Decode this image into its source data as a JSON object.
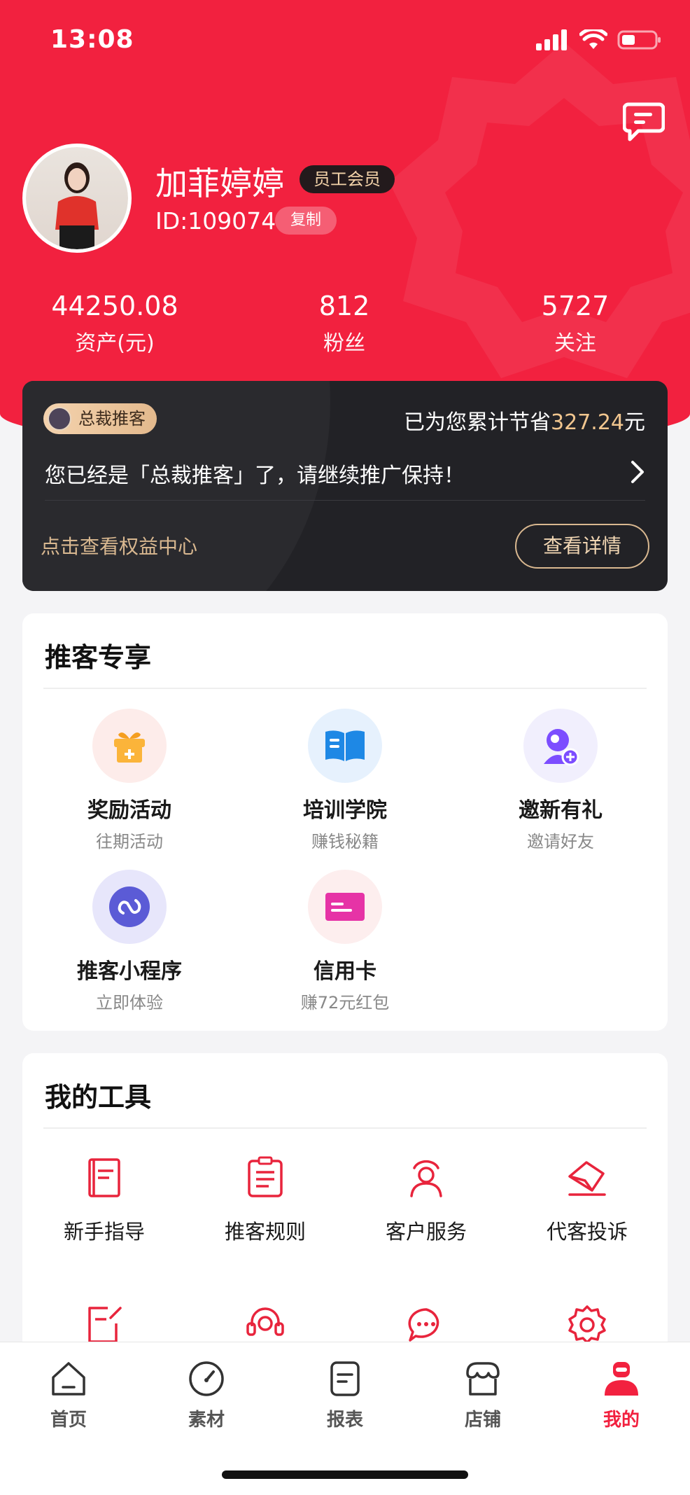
{
  "status_bar": {
    "time": "13:08"
  },
  "profile": {
    "name": "加菲婷婷",
    "member_badge": "员工会员",
    "id_text": "ID:109074",
    "copy_label": "复制"
  },
  "stats": [
    {
      "value": "44250.08",
      "label": "资产(元)"
    },
    {
      "value": "812",
      "label": "粉丝"
    },
    {
      "value": "5727",
      "label": "关注"
    }
  ],
  "vip": {
    "tag": "总裁推客",
    "save_prefix": "已为您累计节省",
    "save_amount": "327.24",
    "save_unit": "元",
    "description": "您已经是「总裁推客」了，请继续推广保持！",
    "center_link": "点击查看权益中心",
    "detail_button": "查看详情"
  },
  "exclusive": {
    "title": "推客专享",
    "items": [
      {
        "title": "奖励活动",
        "subtitle": "往期活动",
        "icon": "gift-icon"
      },
      {
        "title": "培训学院",
        "subtitle": "赚钱秘籍",
        "icon": "book-icon"
      },
      {
        "title": "邀新有礼",
        "subtitle": "邀请好友",
        "icon": "invite-user-icon"
      },
      {
        "title": "推客小程序",
        "subtitle": "立即体验",
        "icon": "mini-program-icon"
      },
      {
        "title": "信用卡",
        "subtitle": "赚72元红包",
        "icon": "credit-card-icon"
      }
    ]
  },
  "tools": {
    "title": "我的工具",
    "items": [
      {
        "label": "新手指导",
        "icon": "guide-book-icon"
      },
      {
        "label": "推客规则",
        "icon": "rules-document-icon"
      },
      {
        "label": "客户服务",
        "icon": "customer-service-icon"
      },
      {
        "label": "代客投诉",
        "icon": "complaint-envelope-icon"
      }
    ],
    "partial_row_icons": [
      "edit-document-icon",
      "headset-icon",
      "chat-bubble-icon",
      "settings-gear-icon"
    ]
  },
  "tabbar": [
    {
      "label": "首页",
      "icon": "home-icon"
    },
    {
      "label": "素材",
      "icon": "compass-icon"
    },
    {
      "label": "报表",
      "icon": "report-icon"
    },
    {
      "label": "店铺",
      "icon": "store-icon"
    },
    {
      "label": "我的",
      "icon": "profile-icon",
      "active": true
    }
  ],
  "colors": {
    "brand_red": "#f2213f",
    "vip_dark": "#222226",
    "gold": "#f1c68f"
  }
}
